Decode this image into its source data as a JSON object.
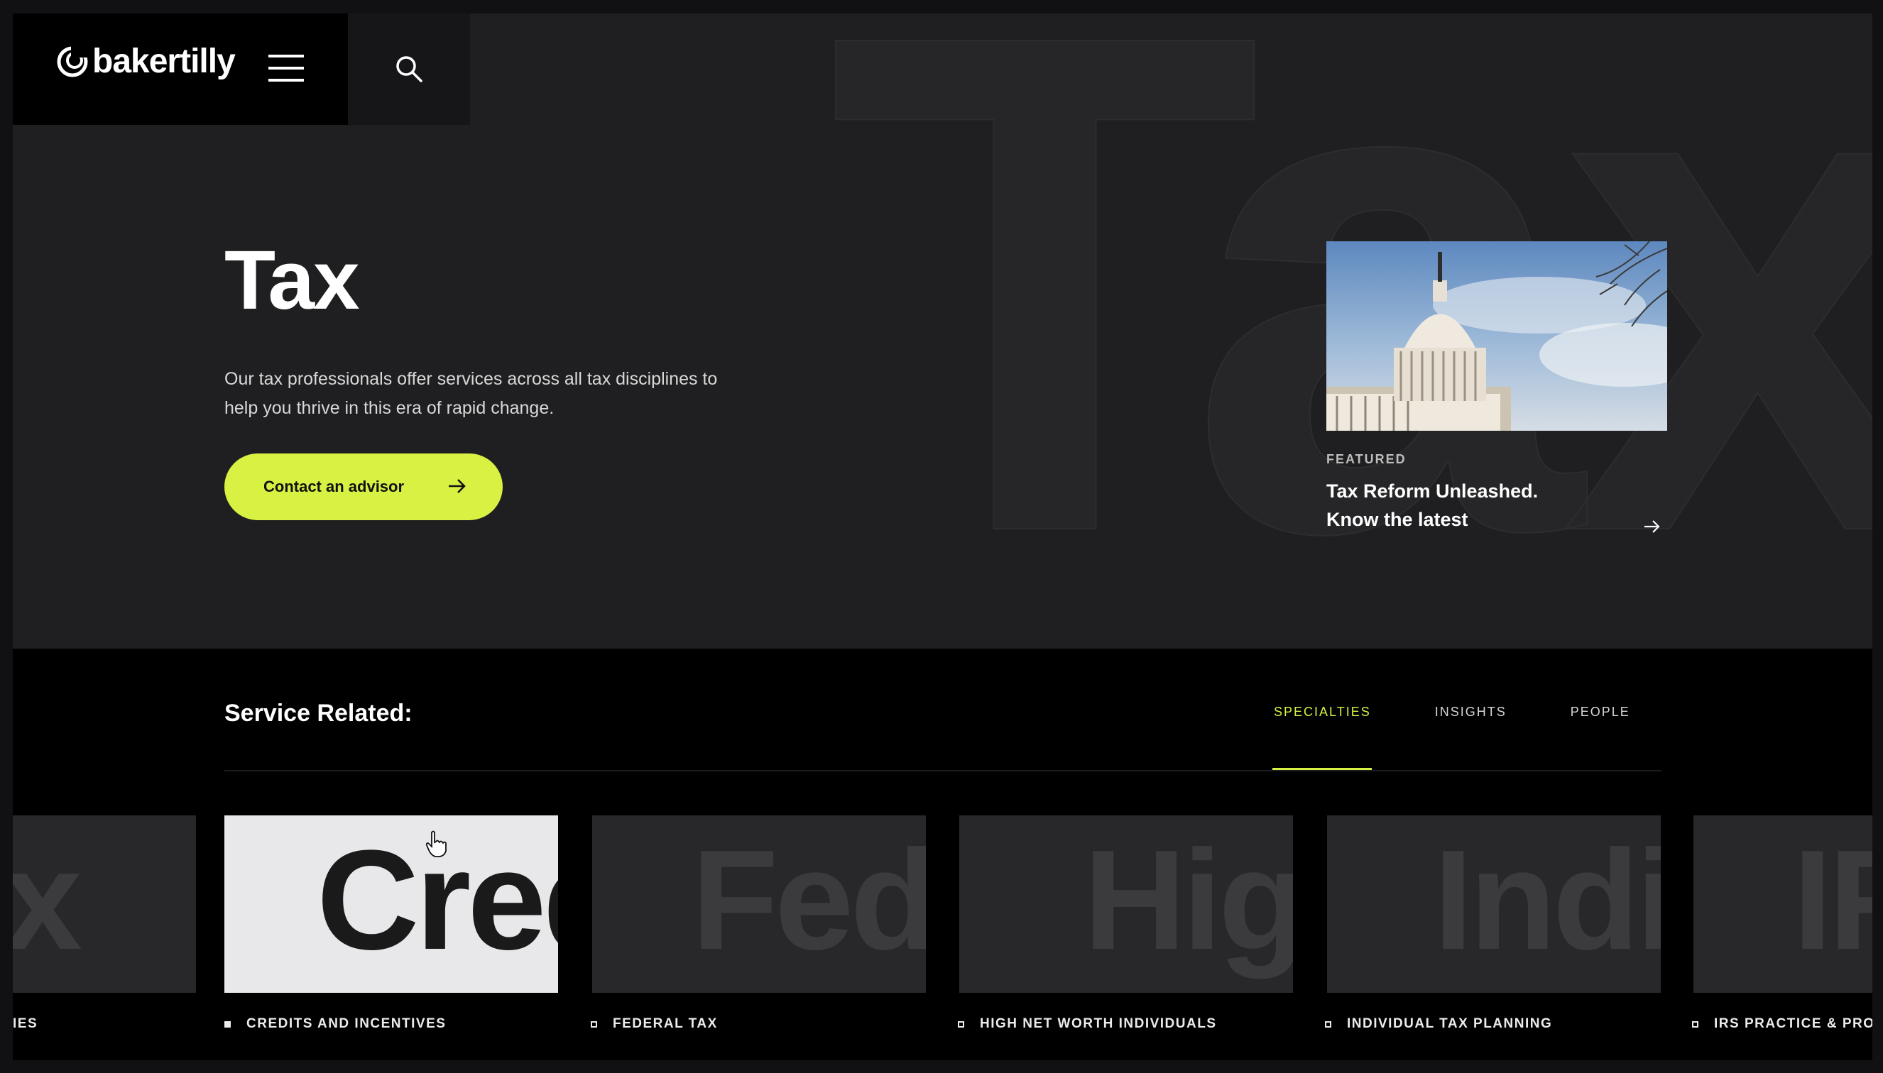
{
  "brand": {
    "name": "bakertilly"
  },
  "hero": {
    "bg_word": "Tax",
    "title": "Tax",
    "description": "Our tax professionals offer services across all tax disciplines to help you thrive in this era of rapid change.",
    "cta_label": "Contact an advisor"
  },
  "featured": {
    "label": "FEATURED",
    "title_line1": "Tax Reform Unleashed.",
    "title_line2": "Know the latest",
    "progress": 0.22
  },
  "related": {
    "title": "Service Related:",
    "tabs": [
      "SPECIALTIES",
      "INSIGHTS",
      "PEOPLE"
    ],
    "active_tab": "SPECIALTIES",
    "cards": [
      {
        "word": "Tax",
        "label": "IES"
      },
      {
        "word": "Cred",
        "label": "CREDITS AND INCENTIVES"
      },
      {
        "word": "Fed",
        "label": "FEDERAL TAX"
      },
      {
        "word": "Hig",
        "label": "HIGH NET WORTH INDIVIDUALS"
      },
      {
        "word": "Indi",
        "label": "INDIVIDUAL TAX PLANNING"
      },
      {
        "word": "IF",
        "label": "IRS PRACTICE & PROC"
      }
    ]
  },
  "colors": {
    "accent": "#d8f143",
    "hero_bg": "#1f1f21",
    "page_bg": "#000000"
  }
}
